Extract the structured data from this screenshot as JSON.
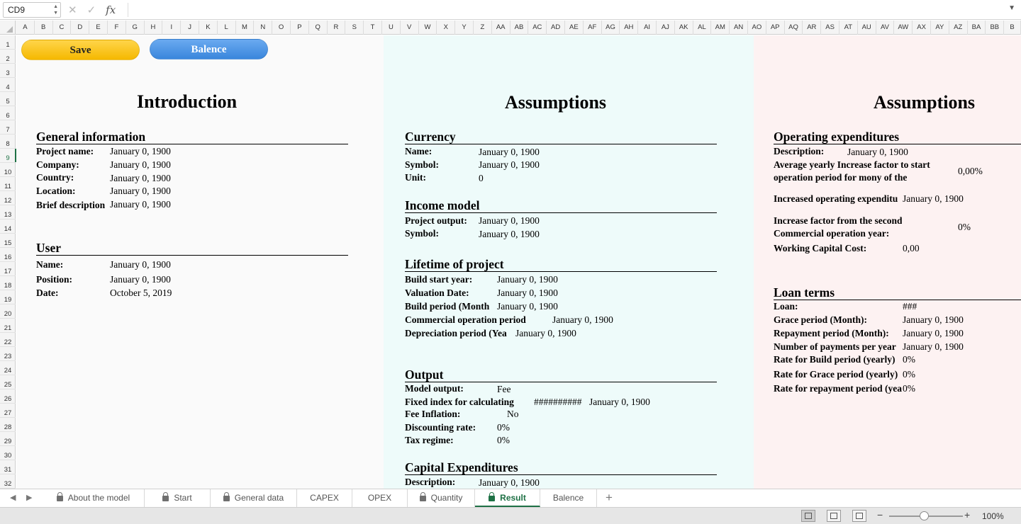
{
  "formula_bar": {
    "cell_ref": "CD9",
    "fx_label": "fx",
    "content": ""
  },
  "columns": [
    "A",
    "B",
    "C",
    "D",
    "E",
    "F",
    "G",
    "H",
    "I",
    "J",
    "K",
    "L",
    "M",
    "N",
    "O",
    "P",
    "Q",
    "R",
    "S",
    "T",
    "U",
    "V",
    "W",
    "X",
    "Y",
    "Z",
    "AA",
    "AB",
    "AC",
    "AD",
    "AE",
    "AF",
    "AG",
    "AH",
    "AI",
    "AJ",
    "AK",
    "AL",
    "AM",
    "AN",
    "AO",
    "AP",
    "AQ",
    "AR",
    "AS",
    "AT",
    "AU",
    "AV",
    "AW",
    "AX",
    "AY",
    "AZ",
    "BA",
    "BB",
    "B"
  ],
  "rows": [
    "1",
    "2",
    "3",
    "4",
    "5",
    "6",
    "7",
    "8",
    "9",
    "10",
    "11",
    "12",
    "13",
    "14",
    "15",
    "16",
    "17",
    "18",
    "19",
    "20",
    "21",
    "22",
    "23",
    "24",
    "25",
    "26",
    "27",
    "28",
    "29",
    "30",
    "31",
    "32"
  ],
  "active_row": "9",
  "buttons": {
    "save": "Save",
    "balence": "Balence"
  },
  "intro": {
    "title": "Introduction",
    "general": {
      "heading": "General information",
      "items": [
        {
          "label": "Project name:",
          "value": "January 0, 1900"
        },
        {
          "label": "Company:",
          "value": "January 0, 1900"
        },
        {
          "label": "Country:",
          "value": "January 0, 1900"
        },
        {
          "label": "Location:",
          "value": "January 0, 1900"
        },
        {
          "label": "Brief description",
          "value": "January 0, 1900"
        }
      ]
    },
    "user": {
      "heading": "User",
      "items": [
        {
          "label": "Name:",
          "value": "January 0, 1900"
        },
        {
          "label": "Position:",
          "value": "January 0, 1900"
        },
        {
          "label": "Date:",
          "value": "October 5, 2019"
        }
      ]
    }
  },
  "assumptions1": {
    "title": "Assumptions",
    "currency": {
      "heading": "Currency",
      "items": [
        {
          "label": "Name:",
          "value": "January 0, 1900"
        },
        {
          "label": "Symbol:",
          "value": "January 0, 1900"
        },
        {
          "label": "Unit:",
          "value": "0"
        }
      ]
    },
    "income": {
      "heading": "Income model",
      "items": [
        {
          "label": "Project output:",
          "value": "January 0, 1900"
        },
        {
          "label": "Symbol:",
          "value": "January 0, 1900"
        }
      ]
    },
    "lifetime": {
      "heading": "Lifetime of project",
      "items": [
        {
          "label": "Build start year:",
          "value": "January 0, 1900"
        },
        {
          "label": "Valuation Date:",
          "value": "January 0, 1900"
        },
        {
          "label": "Build period (Month",
          "value": "January 0, 1900"
        },
        {
          "label": "Commercial operation period",
          "value": "January 0, 1900"
        },
        {
          "label": "Depreciation period (Yea",
          "value": "January 0, 1900"
        }
      ]
    },
    "output": {
      "heading": "Output",
      "items": [
        {
          "label": "Model output:",
          "value": "Fee"
        },
        {
          "label": "Fixed index for calculating",
          "value": "##########",
          "value2": "January 0, 1900"
        },
        {
          "label": "Fee Inflation:",
          "value": "No"
        },
        {
          "label": "Discounting rate:",
          "value": "0%"
        },
        {
          "label": "Tax regime:",
          "value": "0%"
        }
      ]
    },
    "capex": {
      "heading": "Capital Expenditures",
      "items": [
        {
          "label": "Description:",
          "value": "January 0, 1900"
        }
      ]
    }
  },
  "assumptions2": {
    "title": "Assumptions",
    "opex": {
      "heading": "Operating expenditures",
      "description_label": "Description:",
      "description_value": "January 0, 1900",
      "avg_label_1": "Average yearly Increase factor to start",
      "avg_label_2": "operation period for mony of the",
      "avg_value": "0,00%",
      "increased_label": "Increased operating expenditu",
      "increased_value": "January 0, 1900",
      "second_label_1": "Increase factor from the second",
      "second_label_2": "Commercial operation year:",
      "second_value": "0%",
      "wc_label": "Working Capital Cost:",
      "wc_value": "0,00"
    },
    "loan": {
      "heading": "Loan terms",
      "items": [
        {
          "label": "Loan:",
          "value": "###"
        },
        {
          "label": "Grace period (Month):",
          "value": "January 0, 1900"
        },
        {
          "label": "Repayment period (Month):",
          "value": "January 0, 1900"
        },
        {
          "label": "Number of payments per year",
          "value": "January 0, 1900"
        },
        {
          "label": "Rate for Build period (yearly)",
          "value": "0%"
        },
        {
          "label": "Rate for Grace period (yearly)",
          "value": "0%"
        },
        {
          "label": "Rate for repayment period (yearly)",
          "value": "0%"
        }
      ]
    }
  },
  "tabs": [
    {
      "label": "About the model",
      "locked": true
    },
    {
      "label": "Start",
      "locked": true
    },
    {
      "label": "General data",
      "locked": true
    },
    {
      "label": "CAPEX",
      "locked": false
    },
    {
      "label": "OPEX",
      "locked": false
    },
    {
      "label": "Quantity",
      "locked": true
    },
    {
      "label": "Result",
      "locked": true,
      "active": true
    },
    {
      "label": "Balence",
      "locked": false
    }
  ],
  "status": {
    "zoom": "100%"
  }
}
